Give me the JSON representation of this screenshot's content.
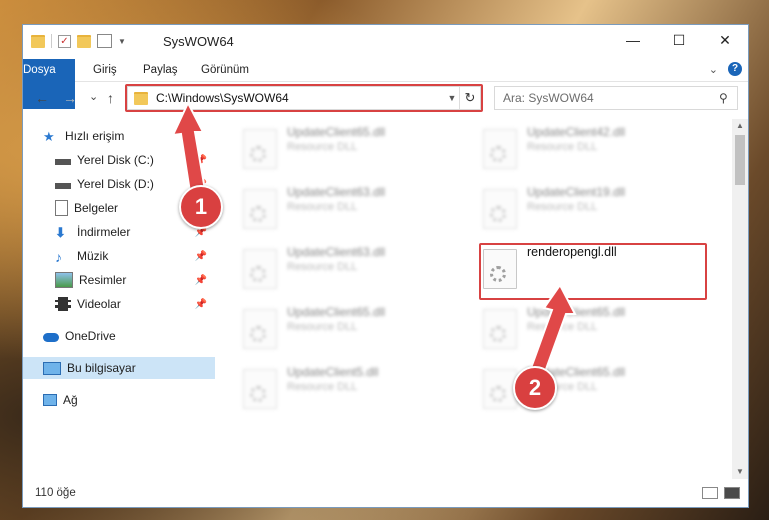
{
  "window": {
    "title": "SysWOW64",
    "controls": {
      "minimize": "—",
      "maximize": "☐",
      "close": "✕"
    }
  },
  "ribbon": {
    "tabs": [
      "Dosya",
      "Giriş",
      "Paylaş",
      "Görünüm"
    ]
  },
  "nav": {
    "back": "←",
    "forward": "→",
    "recent": "⌄",
    "up": "↑",
    "address": "C:\\Windows\\SysWOW64",
    "search_placeholder": "Ara: SysWOW64"
  },
  "sidebar": {
    "items": [
      {
        "label": "Hızlı erişim"
      },
      {
        "label": "Yerel Disk (C:)"
      },
      {
        "label": "Yerel Disk (D:)"
      },
      {
        "label": "Belgeler"
      },
      {
        "label": "İndirmeler"
      },
      {
        "label": "Müzik"
      },
      {
        "label": "Resimler"
      },
      {
        "label": "Videolar"
      },
      {
        "label": "OneDrive"
      },
      {
        "label": "Bu bilgisayar"
      },
      {
        "label": "Ağ"
      }
    ]
  },
  "files": [
    {
      "name": "UpdateClient65.dll",
      "type": "Resource DLL"
    },
    {
      "name": "UpdateClient42.dll",
      "type": "Resource DLL"
    },
    {
      "name": "UpdateClient63.dll",
      "type": "Resource DLL"
    },
    {
      "name": "UpdateClient19.dll",
      "type": "Resource DLL"
    },
    {
      "name": "UpdateClient63.dll",
      "type": "Resource DLL"
    },
    {
      "name": "renderopengl.dll",
      "type": ""
    },
    {
      "name": "UpdateClient65.dll",
      "type": "Resource DLL"
    },
    {
      "name": "UpdateClient65.dll",
      "type": "Resource DLL"
    },
    {
      "name": "UpdateClient5.dll",
      "type": "Resource DLL"
    },
    {
      "name": "UpdateClient65.dll",
      "type": "Resource DLL"
    }
  ],
  "status": {
    "count": "110 öğe"
  },
  "markers": [
    "1",
    "2"
  ],
  "colors": {
    "accent": "#1a65b8",
    "highlight": "#d84242",
    "selection": "#cce4f7"
  }
}
